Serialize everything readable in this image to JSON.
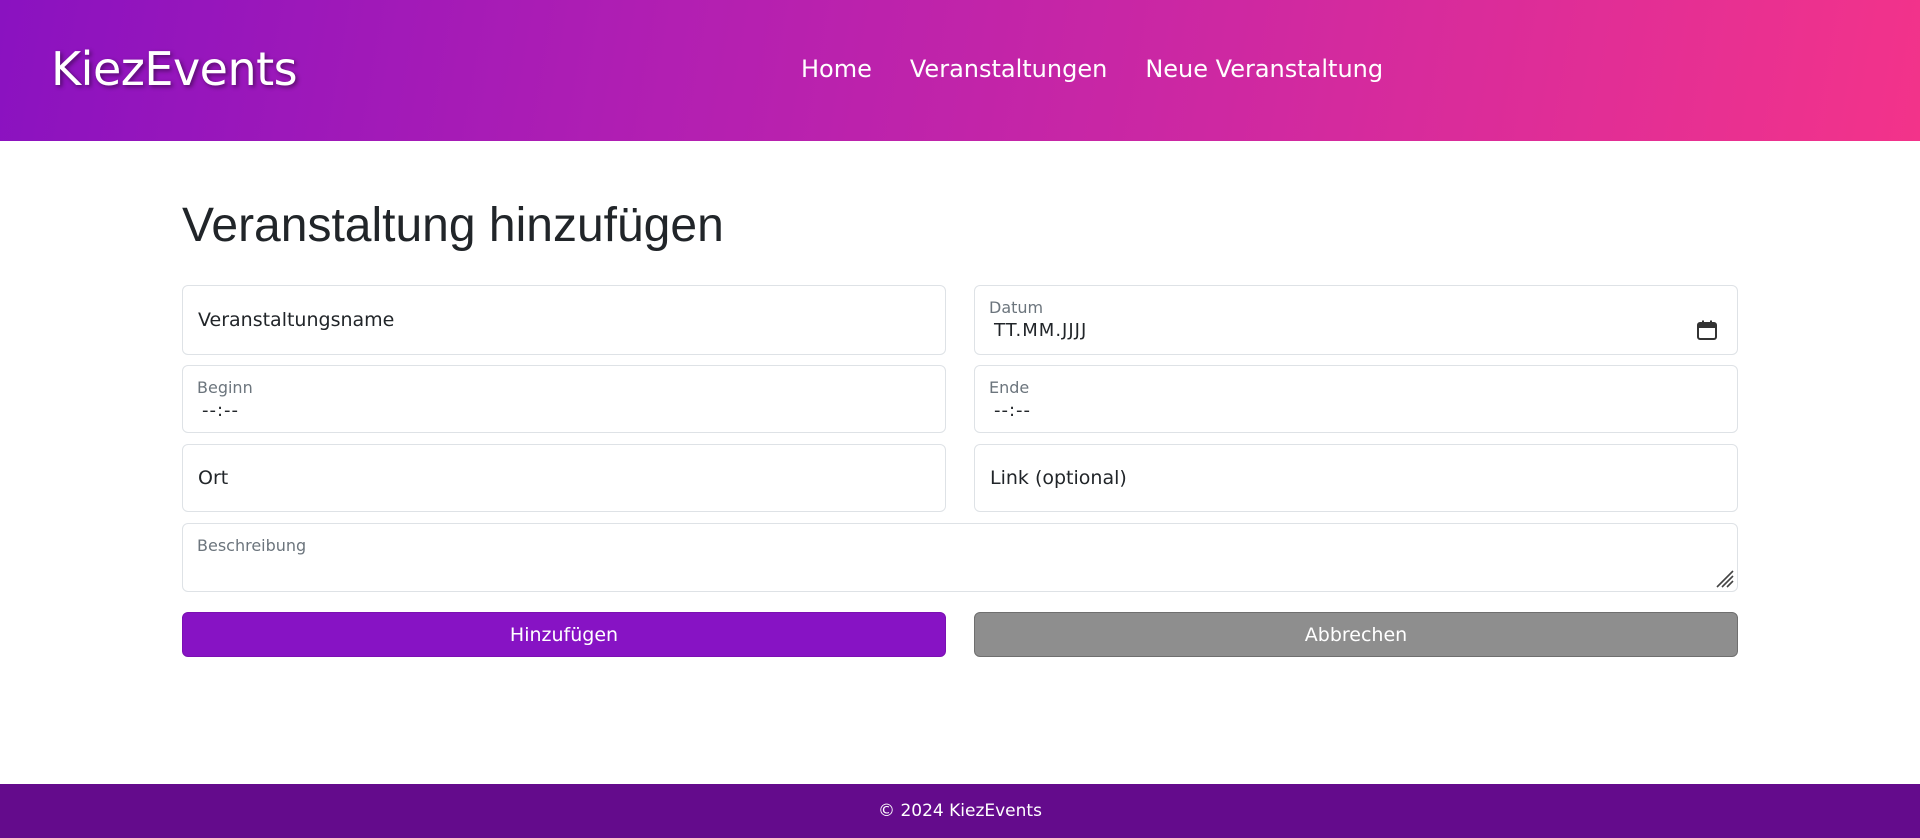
{
  "header": {
    "brand": "KiezEvents",
    "nav": [
      "Home",
      "Veranstaltungen",
      "Neue Veranstaltung"
    ],
    "gradient": [
      "#8a12c0",
      "#f3338a"
    ]
  },
  "main": {
    "title": "Veranstaltung hinzufügen",
    "form": {
      "name_placeholder": "Veranstaltungsname",
      "date_label": "Datum",
      "date_value": "TT.MM.JJJJ",
      "start_label": "Beginn",
      "start_value": "--:--",
      "end_label": "Ende",
      "end_value": "--:--",
      "location_placeholder": "Ort",
      "link_placeholder": "Link (optional)",
      "description_label": "Beschreibung"
    },
    "buttons": {
      "submit": "Hinzufügen",
      "cancel": "Abbrechen"
    }
  },
  "footer": {
    "text": "© 2024 KiezEvents"
  },
  "colors": {
    "primary": "#8713c4",
    "secondary": "#8e8e8e",
    "footer": "#640b8c"
  },
  "icons": [
    "calendar-icon",
    "resize-handle-icon"
  ]
}
